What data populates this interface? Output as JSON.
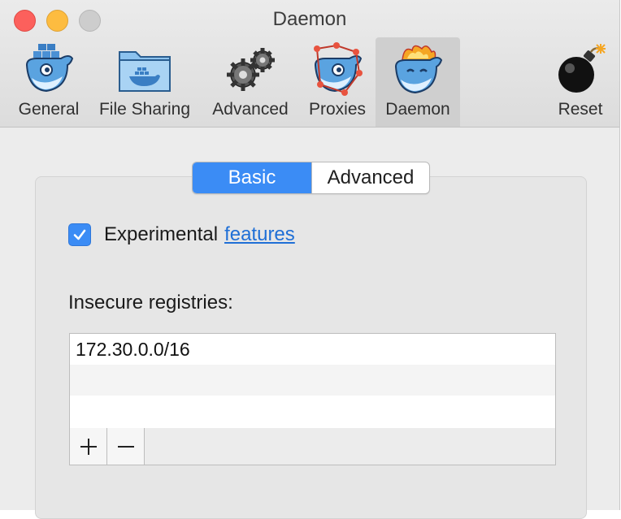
{
  "window": {
    "title": "Daemon"
  },
  "toolbar": {
    "items": [
      {
        "label": "General",
        "icon": "docker-whale-icon"
      },
      {
        "label": "File Sharing",
        "icon": "shared-folder-icon"
      },
      {
        "label": "Advanced",
        "icon": "gears-icon"
      },
      {
        "label": "Proxies",
        "icon": "proxy-whale-icon"
      },
      {
        "label": "Daemon",
        "icon": "daemon-whale-icon"
      },
      {
        "label": "Reset",
        "icon": "bomb-icon"
      }
    ],
    "selected": "Daemon"
  },
  "segmented": {
    "basic": "Basic",
    "advanced": "Advanced",
    "selected": "Basic"
  },
  "experimental": {
    "label": "Experimental",
    "link": "features",
    "checked": true
  },
  "registries": {
    "label": "Insecure registries:",
    "rows": [
      "172.30.0.0/16",
      "",
      ""
    ],
    "add_icon": "plus-icon",
    "remove_icon": "minus-icon"
  },
  "colors": {
    "accent": "#3b8cf5",
    "link": "#1f6fd6",
    "close": "#fc605c",
    "minimize": "#fdbc40",
    "zoom": "#cdcdcd"
  }
}
